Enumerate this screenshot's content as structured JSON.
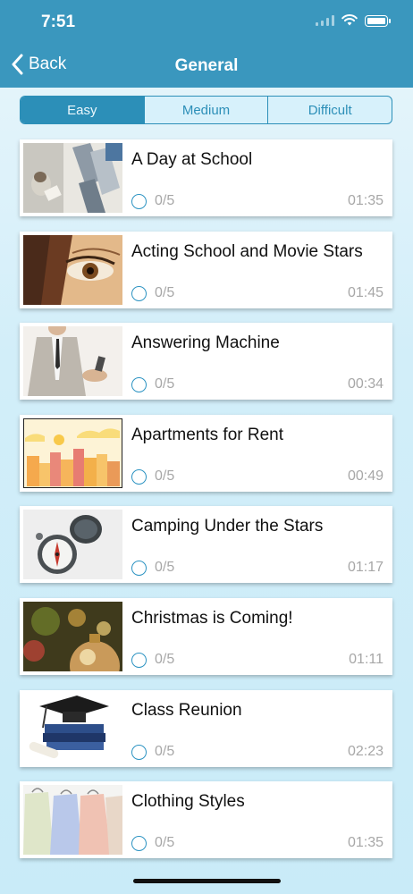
{
  "status": {
    "time": "7:51"
  },
  "nav": {
    "back_label": "Back",
    "title": "General"
  },
  "tabs": [
    {
      "label": "Easy",
      "active": true
    },
    {
      "label": "Medium",
      "active": false
    },
    {
      "label": "Difficult",
      "active": false
    }
  ],
  "lessons": [
    {
      "title": "A Day at School",
      "progress": "0/5",
      "duration": "01:35",
      "thumb": "school-desk-photo"
    },
    {
      "title": "Acting School and Movie Stars",
      "progress": "0/5",
      "duration": "01:45",
      "thumb": "eye-closeup-photo"
    },
    {
      "title": "Answering Machine",
      "progress": "0/5",
      "duration": "00:34",
      "thumb": "businessman-phone-photo"
    },
    {
      "title": "Apartments for Rent",
      "progress": "0/5",
      "duration": "00:49",
      "thumb": "city-buildings-illustration"
    },
    {
      "title": "Camping Under the Stars",
      "progress": "0/5",
      "duration": "01:17",
      "thumb": "compass-photo"
    },
    {
      "title": "Christmas is Coming!",
      "progress": "0/5",
      "duration": "01:11",
      "thumb": "christmas-ornament-photo"
    },
    {
      "title": "Class Reunion",
      "progress": "0/5",
      "duration": "02:23",
      "thumb": "graduation-cap-books-photo"
    },
    {
      "title": "Clothing Styles",
      "progress": "0/5",
      "duration": "01:35",
      "thumb": "shirts-on-hangers-photo"
    }
  ],
  "colors": {
    "header": "#3a97be",
    "accent": "#2c8fb8",
    "muted": "#a7a7a7"
  }
}
